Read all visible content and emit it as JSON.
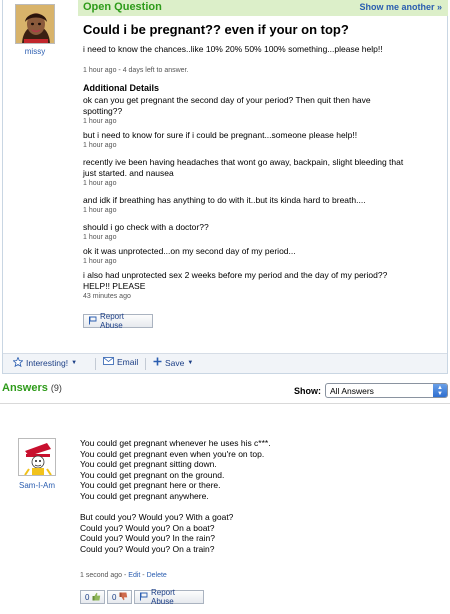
{
  "question": {
    "header_label": "Open Question",
    "show_another": "Show me another »",
    "asker_name": "missy",
    "title": "Could i be pregnant?? even if your on top?",
    "body": "i need to know the chances..like 10% 20% 50% 100% something...please help!!",
    "meta": "1 hour ago - 4 days left to answer.",
    "additional_details_heading": "Additional Details",
    "details": [
      {
        "lines": [
          "ok can you get pregnant the second day of your period? Then quit then have",
          "spotting??"
        ],
        "meta": "1 hour ago"
      },
      {
        "lines": [
          "but i need to know for sure if i could be pregnant...someone please help!!"
        ],
        "meta": "1 hour ago"
      },
      {
        "lines": [
          "recently ive been having headaches that wont go away, backpain, slight bleeding that",
          "just started. and nausea"
        ],
        "meta": "1 hour ago"
      },
      {
        "lines": [
          "and idk if breathing has anything to do with it..but its kinda hard to breath...."
        ],
        "meta": "1 hour ago"
      },
      {
        "lines": [
          "should i go check with a doctor??"
        ],
        "meta": "1 hour ago"
      },
      {
        "lines": [
          "ok it was unprotected...on my second day of my period..."
        ],
        "meta": "1 hour ago"
      },
      {
        "lines": [
          "i also had unprotected sex 2 weeks before my period and the day of my period??",
          "HELP!! PLEASE"
        ],
        "meta": "43 minutes ago"
      }
    ],
    "report_abuse": "Report Abuse"
  },
  "actions": {
    "interesting": "Interesting!",
    "email": "Email",
    "save": "Save"
  },
  "answers": {
    "heading": "Answers",
    "count": "(9)",
    "show_label": "Show:",
    "filter_selected": "All Answers",
    "items": [
      {
        "author": "Sam-I-Am",
        "lines": [
          "You could get pregnant whenever he uses his c***.",
          "You could get pregnant even when you're on top.",
          "You could get pregnant sitting down.",
          "You could get pregnant on the ground.",
          "You could get pregnant here or there.",
          "You could get pregnant anywhere.",
          "",
          "But could you? Would you? With a goat?",
          "Could you? Would you? On a boat?",
          "Could you? Would you? In the rain?",
          "Could you? Would you? On a train?"
        ],
        "time": "1 second ago",
        "edit": "Edit",
        "delete": "Delete",
        "thumbs_up": "0",
        "thumbs_down": "0",
        "report_abuse": "Report Abuse"
      }
    ]
  },
  "colors": {
    "accent_green": "#2e9b1a",
    "link_blue": "#2a5db0",
    "header_bg": "#dcefc9"
  }
}
